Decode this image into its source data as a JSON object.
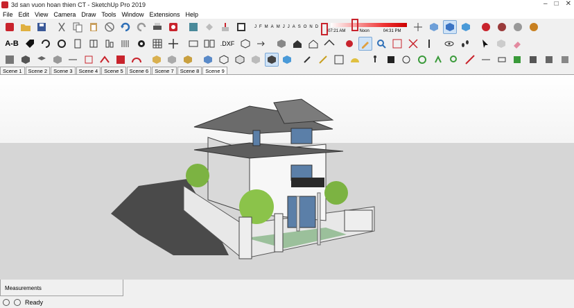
{
  "app": {
    "title": "3d san vuon hoan thien CT - SketchUp Pro 2019",
    "window_controls": [
      "–",
      "□",
      "✕"
    ]
  },
  "menu": [
    "File",
    "Edit",
    "View",
    "Camera",
    "Draw",
    "Tools",
    "Window",
    "Extensions",
    "Help"
  ],
  "shadows": {
    "months": [
      "J",
      "F",
      "M",
      "A",
      "M",
      "J",
      "J",
      "A",
      "S",
      "O",
      "N",
      "D"
    ],
    "time_start": "07:21 AM",
    "time_mid": "Noon",
    "time_end": "04:31 PM"
  },
  "toolbar_colors": {
    "accent": "#c8232c",
    "blue": "#2e6fb7",
    "green": "#3a9a3a",
    "gray": "#777777"
  },
  "scenes": [
    "Scene 1",
    "Scene 2",
    "Scene 3",
    "Scene 4",
    "Scene 5",
    "Scene 6",
    "Scene 7",
    "Scene 8",
    "Scene 9"
  ],
  "active_scene": "Scene 9",
  "measurements_label": "Measurements",
  "status": {
    "text": "Ready"
  },
  "row2_labels": {
    "ab": "A-B",
    "dxf": ".DXF"
  }
}
